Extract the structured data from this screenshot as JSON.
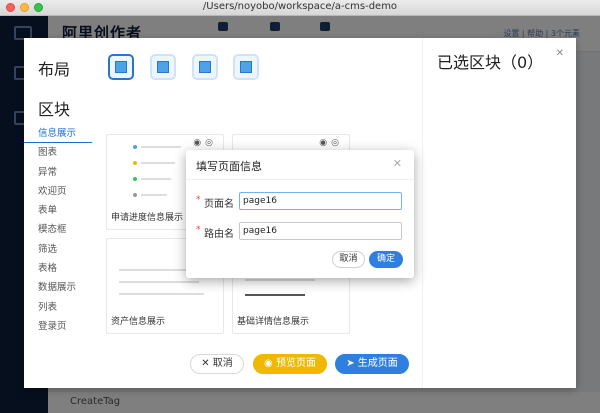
{
  "window": {
    "title": "/Users/noyobo/workspace/a-cms-demo"
  },
  "app": {
    "brand": "阿里创作者",
    "header_right": "设置 | 帮助 | 3个元素",
    "footer_text": "CreateTag"
  },
  "drawer": {
    "layout_title": "布局",
    "block_title": "区块",
    "selected_title": "已选区块（0）",
    "categories": [
      "信息展示",
      "图表",
      "异常",
      "欢迎页",
      "表单",
      "模态框",
      "筛选",
      "表格",
      "数据展示",
      "列表",
      "登录页"
    ],
    "active_category": "信息展示",
    "cards": [
      {
        "label": "申请进度信息展示"
      },
      {
        "label": ""
      },
      {
        "label": "资产信息展示"
      },
      {
        "label": "基础详情信息展示"
      }
    ],
    "buttons": {
      "cancel": "取消",
      "preview": "预览页面",
      "generate": "生成页面"
    }
  },
  "dialog": {
    "title": "填写页面信息",
    "page_name_label": "页面名",
    "page_name_value": "page16",
    "route_name_label": "路由名",
    "route_name_value": "page16",
    "cancel": "取消",
    "ok": "确定"
  },
  "colors": {
    "primary": "#2f7fe0",
    "warning": "#f0b800",
    "required": "#f04134",
    "sidebar": "#0d1e3a"
  }
}
